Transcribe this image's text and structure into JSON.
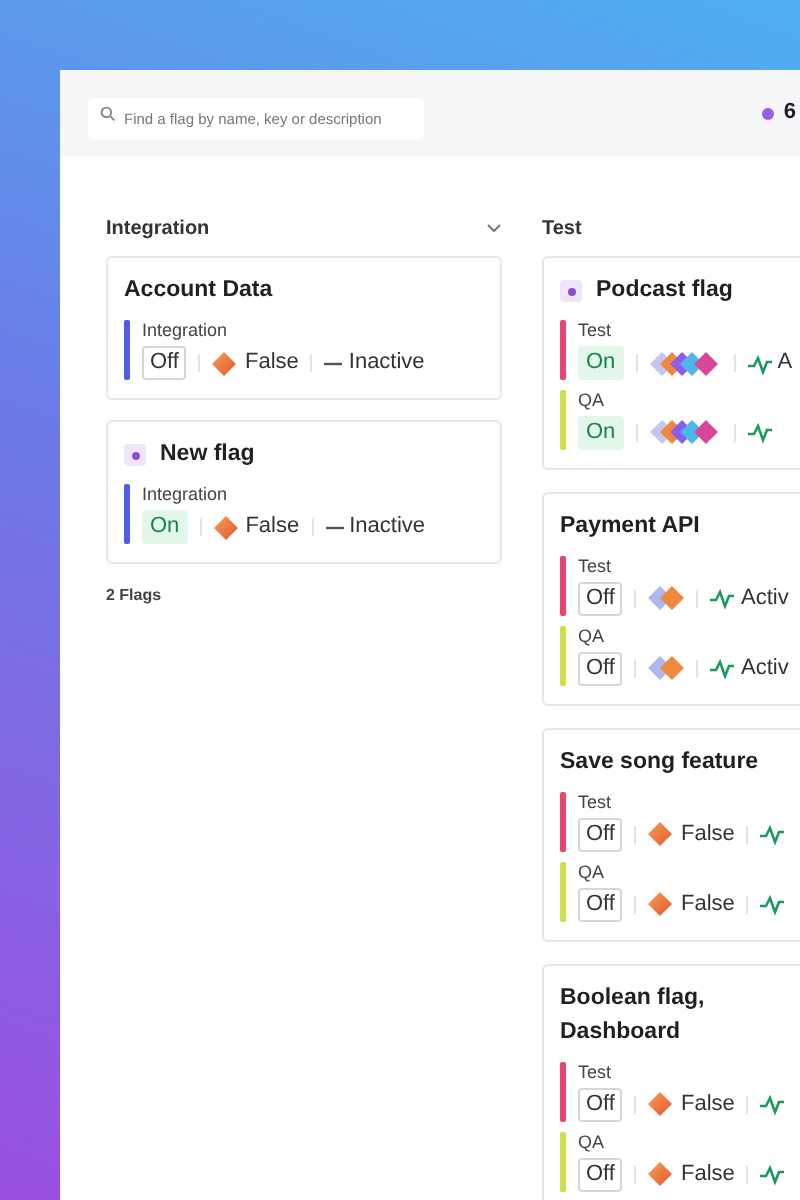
{
  "search": {
    "placeholder": "Find a flag by name, key or description"
  },
  "counter": {
    "text": "6",
    "color": "#9b5de5"
  },
  "columns": [
    {
      "title": "Integration",
      "expanded": true,
      "footer": "2 Flags",
      "cards": [
        {
          "name": "Account Data",
          "new": false,
          "environments": [
            {
              "name": "Integration",
              "color": "#4f5fe3",
              "on": false,
              "toggle": "Off",
              "variation": {
                "kind": "single",
                "label": "False"
              },
              "status": {
                "kind": "inactive",
                "label": "Inactive"
              }
            }
          ]
        },
        {
          "name": "New flag",
          "new": true,
          "environments": [
            {
              "name": "Integration",
              "color": "#4f5fe3",
              "on": true,
              "toggle": "On",
              "variation": {
                "kind": "single",
                "label": "False"
              },
              "status": {
                "kind": "inactive",
                "label": "Inactive"
              }
            }
          ]
        }
      ]
    },
    {
      "title": "Test",
      "cards": [
        {
          "name": "Podcast flag",
          "new": true,
          "environments": [
            {
              "name": "Test",
              "color": "#e8456e",
              "on": true,
              "toggle": "On",
              "variation": {
                "kind": "many"
              },
              "status": {
                "kind": "active",
                "label": "A"
              }
            },
            {
              "name": "QA",
              "color": "#cfe04a",
              "on": true,
              "toggle": "On",
              "variation": {
                "kind": "many"
              },
              "status": {
                "kind": "active"
              }
            }
          ]
        },
        {
          "name": "Payment API",
          "new": false,
          "environments": [
            {
              "name": "Test",
              "color": "#e8456e",
              "on": false,
              "toggle": "Off",
              "variation": {
                "kind": "pair"
              },
              "status": {
                "kind": "active",
                "label": "Activ"
              }
            },
            {
              "name": "QA",
              "color": "#cfe04a",
              "on": false,
              "toggle": "Off",
              "variation": {
                "kind": "pair"
              },
              "status": {
                "kind": "active",
                "label": "Activ"
              }
            }
          ]
        },
        {
          "name": "Save song feature",
          "new": false,
          "environments": [
            {
              "name": "Test",
              "color": "#e8456e",
              "on": false,
              "toggle": "Off",
              "variation": {
                "kind": "single",
                "label": "False"
              },
              "status": {
                "kind": "active"
              }
            },
            {
              "name": "QA",
              "color": "#cfe04a",
              "on": false,
              "toggle": "Off",
              "variation": {
                "kind": "single",
                "label": "False"
              },
              "status": {
                "kind": "active"
              }
            }
          ]
        },
        {
          "name": "Boolean flag, Dashboard",
          "new": false,
          "environments": [
            {
              "name": "Test",
              "color": "#e8456e",
              "on": false,
              "toggle": "Off",
              "variation": {
                "kind": "single",
                "label": "False"
              },
              "status": {
                "kind": "active"
              }
            },
            {
              "name": "QA",
              "color": "#cfe04a",
              "on": false,
              "toggle": "Off",
              "variation": {
                "kind": "single",
                "label": "False"
              },
              "status": {
                "kind": "active"
              }
            }
          ]
        }
      ]
    }
  ]
}
